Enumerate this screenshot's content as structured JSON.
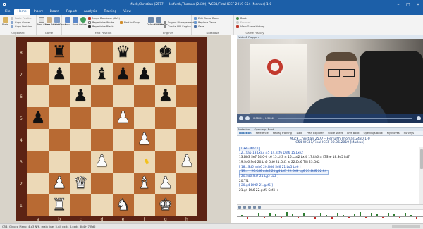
{
  "window": {
    "title": "Muck,Christian (2577) - Herfurth,Thomas (2430), WC31/Final ICCF 2019  C54  (Markus) 1-0"
  },
  "ribbon": {
    "tabs": [
      "File",
      "Home",
      "Insert",
      "Board",
      "Report",
      "Analysis",
      "Training",
      "View"
    ],
    "active_tab": "Home",
    "clipboard": {
      "group": "Clipboard",
      "paste": "Paste",
      "copy_game": "Copy Game",
      "copy_position": "Copy Position",
      "paste_position": "Paste Position"
    },
    "game": {
      "group": "Game",
      "new_game": "New Game",
      "new_position": "New Position",
      "hard_game": "Hard Game"
    },
    "find": {
      "group": "Find Position",
      "prev": "Prev",
      "next": "Next",
      "online": "Online",
      "mega_database": "Mega Database (Kb5)",
      "repertoire_white": "Repertoire White",
      "repertoire_black": "Repertoire Black",
      "find_in_shop": "Find in Shop"
    },
    "engines": {
      "group": "Engines",
      "default_kibitzer": "Default Kibitzer",
      "add_kibitzer": "Add Kibitzer",
      "engine_management": "Engine Management",
      "create_uci_engine": "Create UCI Engine"
    },
    "database": {
      "group": "Database",
      "edit_game_data": "Edit Game Data",
      "replace_game": "Replace Game",
      "save": "Save"
    },
    "history": {
      "group": "Game History",
      "back": "Back",
      "forward": "Forward",
      "view_game_history": "View Game History"
    }
  },
  "board": {
    "ranks": [
      "8",
      "7",
      "6",
      "5",
      "4",
      "3",
      "2",
      "1"
    ],
    "files": [
      "a",
      "b",
      "c",
      "d",
      "e",
      "f",
      "g",
      "h"
    ],
    "position": [
      [
        "",
        "r",
        "",
        "",
        "q",
        "",
        "k",
        ""
      ],
      [
        "",
        "p",
        "",
        "b",
        "p",
        "p",
        "",
        ""
      ],
      [
        "",
        "",
        "p",
        "",
        "",
        "",
        "p",
        ""
      ],
      [
        "p",
        "",
        "",
        "",
        "P",
        "",
        "",
        ""
      ],
      [
        "",
        "",
        "",
        "",
        "",
        "P",
        "",
        ""
      ],
      [
        "",
        "",
        "",
        "P",
        "",
        "",
        "",
        "P"
      ],
      [
        "",
        "P",
        "Q",
        "",
        "",
        "B",
        "P",
        ""
      ],
      [
        "",
        "R",
        "",
        "",
        "N",
        "",
        "K",
        ""
      ]
    ]
  },
  "video": {
    "header": "Video1 Ruggen",
    "time": "0:08:00 / 0:24:40"
  },
  "notation": {
    "header": "Notation — Openings Book",
    "tabs": [
      "Notation",
      "Reference",
      "Replay training",
      "Table",
      "Plan Explorer",
      "Score sheet",
      "Live Book",
      "Openings Book",
      "My Moves",
      "Surveys"
    ],
    "active_tab": "Notation",
    "players": "Muck,Christian 2577 – Herfurth,Thomas 2430 1-0",
    "event": "C54 WC31/Final ICCF 20.06.2019 [Markus]",
    "lines": [
      "[ 12...Se5 ]",
      "12...Sa5    13.Lxc3 ±5 14.exf6 Dxf6 15.Lxe2 ]",
      "13.Db3 Se7 14.0-0 c6 15.Lh3 ± 16.Lxd2 Lxf4 17.Lh6 ± LTS ⊕ 18.Se5 Ld7",
      "19.Sd6 Se5 20.Lh6 Dd6 21.Dd1 ± 22.Dd6 Tf8 23.Dd2",
      "[ 18...Sd6 axb6 20.Dd4 Sd6 21.Lg5 Le6 ]",
      "19...→  20.Sd6 axb6 21.g4 Ld7 22.Dd6 Lg6 23.Dd5 22.h4",
      "[ 20.Sd6 Sd7 21.Lg5 Lb2 ]",
      "20.Tf1",
      "[ 20.g4 Dh6! 21.gxf5 ]",
      "21.g4 Dh6 22.gxf5 Sxf4 + −"
    ]
  },
  "status": {
    "text": "C54: Giuoco Piano: 4.c3 Nf6, main line: 5.d4 exd4 6.cxd4 Bb4+ 7.Bd2"
  }
}
